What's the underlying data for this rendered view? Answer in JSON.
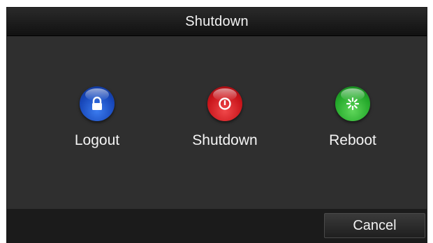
{
  "dialog": {
    "title": "Shutdown"
  },
  "actions": [
    {
      "label": "Logout",
      "icon": "lock-icon",
      "color": "#1f56d0"
    },
    {
      "label": "Shutdown",
      "icon": "power-icon",
      "color": "#d01b21"
    },
    {
      "label": "Reboot",
      "icon": "reboot-icon",
      "color": "#2cb033"
    }
  ],
  "footer": {
    "cancel_label": "Cancel"
  },
  "colors": {
    "background": "#2f2f2f",
    "titlebar": "#151515",
    "text": "#f2f2f2"
  }
}
